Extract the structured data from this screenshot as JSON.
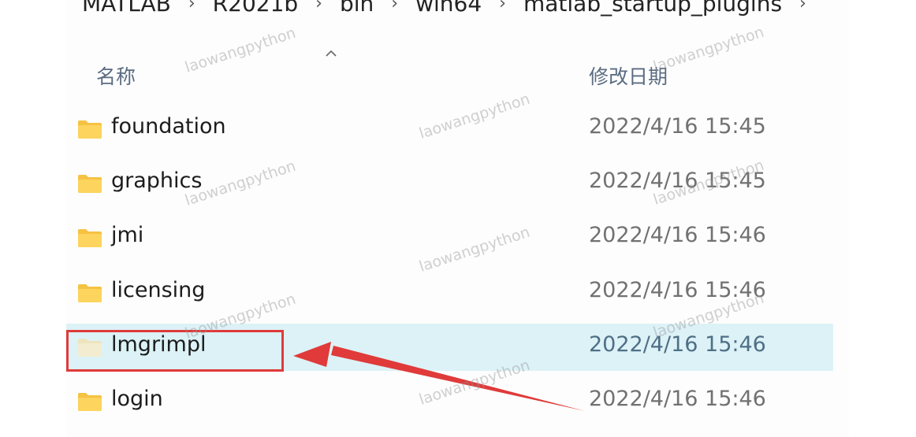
{
  "breadcrumb": {
    "items": [
      "MATLAB",
      "R2021b",
      "bin",
      "win64",
      "matlab_startup_plugins"
    ],
    "separator": "›"
  },
  "columns": {
    "name": "名称",
    "modified": "修改日期"
  },
  "rows": [
    {
      "name": "foundation",
      "date": "2022/4/16 15:45"
    },
    {
      "name": "graphics",
      "date": "2022/4/16 15:45"
    },
    {
      "name": "jmi",
      "date": "2022/4/16 15:46"
    },
    {
      "name": "licensing",
      "date": "2022/4/16 15:46"
    },
    {
      "name": "lmgrimpl",
      "date": "2022/4/16 15:46"
    },
    {
      "name": "login",
      "date": "2022/4/16 15:46"
    }
  ],
  "selected_row": "lmgrimpl",
  "watermark": "laowangpython",
  "colors": {
    "folder": "#f6c243",
    "selection": "#dcf2f7",
    "annotation": "#e03a3a"
  },
  "icons": {
    "folder": "folder-icon",
    "sort": "sort-ascending-icon"
  }
}
